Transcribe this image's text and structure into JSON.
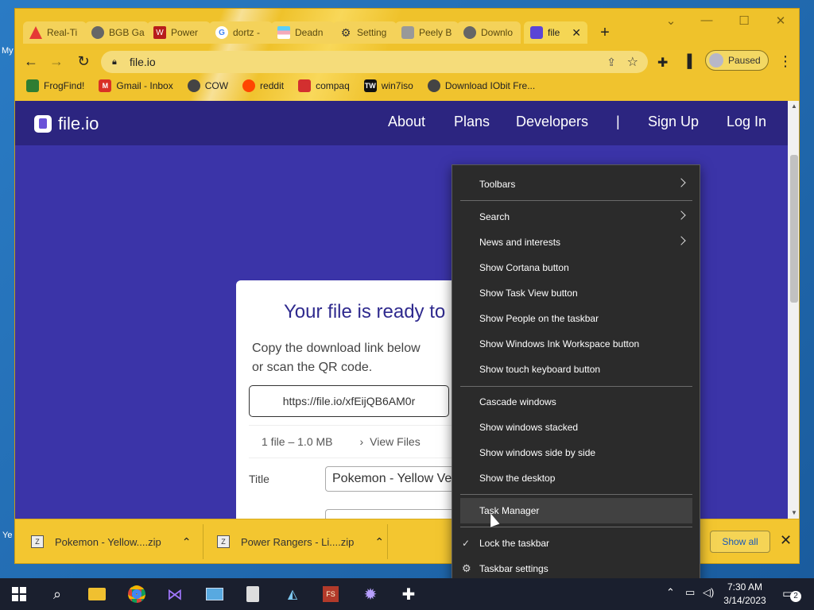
{
  "desktop": {
    "left_text": [
      "My",
      "Ye"
    ]
  },
  "browser": {
    "tabs": [
      {
        "label": "Real-Ti",
        "icon": "warning-icon",
        "color": "#e53935"
      },
      {
        "label": "BGB Ga",
        "icon": "globe-icon",
        "color": "#666666"
      },
      {
        "label": "Power",
        "icon": "w-logo-icon",
        "color": "#b71c1c"
      },
      {
        "label": "dortz -",
        "icon": "google-icon",
        "color": "#4285f4"
      },
      {
        "label": "Deadn",
        "icon": "flag-icon",
        "color": "#9c27b0"
      },
      {
        "label": "Setting",
        "icon": "gear-icon",
        "color": "#333333"
      },
      {
        "label": "Peely B",
        "icon": "fortnite-icon",
        "color": "#888888"
      },
      {
        "label": "Downlo",
        "icon": "globe-icon",
        "color": "#666666"
      },
      {
        "label": "file",
        "icon": "fileio-icon",
        "color": "#5b45d6",
        "active": true
      }
    ],
    "url": "file.io",
    "profile_label": "Paused",
    "bookmarks": [
      {
        "label": "FrogFind!",
        "color": "#2e7d32"
      },
      {
        "label": "Gmail - Inbox",
        "color": "#d93025"
      },
      {
        "label": "COW",
        "color": "#444444"
      },
      {
        "label": "reddit",
        "color": "#ff4500"
      },
      {
        "label": "compaq",
        "color": "#d32f2f"
      },
      {
        "label": "win7iso",
        "color": "#111111"
      },
      {
        "label": "Download IObit Fre...",
        "color": "#444444"
      }
    ]
  },
  "site": {
    "brand": "file.io",
    "nav": [
      "About",
      "Plans",
      "Developers",
      "|",
      "Sign Up",
      "Log In"
    ],
    "card": {
      "title": "Your file is ready to",
      "desc_line1": "Copy the download link below",
      "desc_line2": "or scan the QR code.",
      "link": "https://file.io/xfEijQB6AM0r",
      "file_info": "1 file – 1.0 MB",
      "view_files": "View Files",
      "title_label": "Title",
      "title_value": "Pokemon - Yellow Ve"
    }
  },
  "downloads": {
    "items": [
      "Pokemon - Yellow....zip",
      "Power Rangers - Li....zip"
    ],
    "show_all": "Show all"
  },
  "context_menu": {
    "items": [
      {
        "label": "Toolbars",
        "submenu": true
      },
      {
        "label": "Search",
        "submenu": true
      },
      {
        "label": "News and interests",
        "submenu": true
      },
      {
        "label": "Show Cortana button"
      },
      {
        "label": "Show Task View button"
      },
      {
        "label": "Show People on the taskbar"
      },
      {
        "label": "Show Windows Ink Workspace button"
      },
      {
        "label": "Show touch keyboard button"
      },
      {
        "label": "Cascade windows"
      },
      {
        "label": "Show windows stacked"
      },
      {
        "label": "Show windows side by side"
      },
      {
        "label": "Show the desktop"
      },
      {
        "label": "Task Manager",
        "hover": true
      },
      {
        "label": "Lock the taskbar",
        "checked": true
      },
      {
        "label": "Taskbar settings",
        "icon": "gear-icon"
      }
    ]
  },
  "taskbar": {
    "time": "7:30 AM",
    "date": "3/14/2023",
    "notification_count": "2"
  }
}
